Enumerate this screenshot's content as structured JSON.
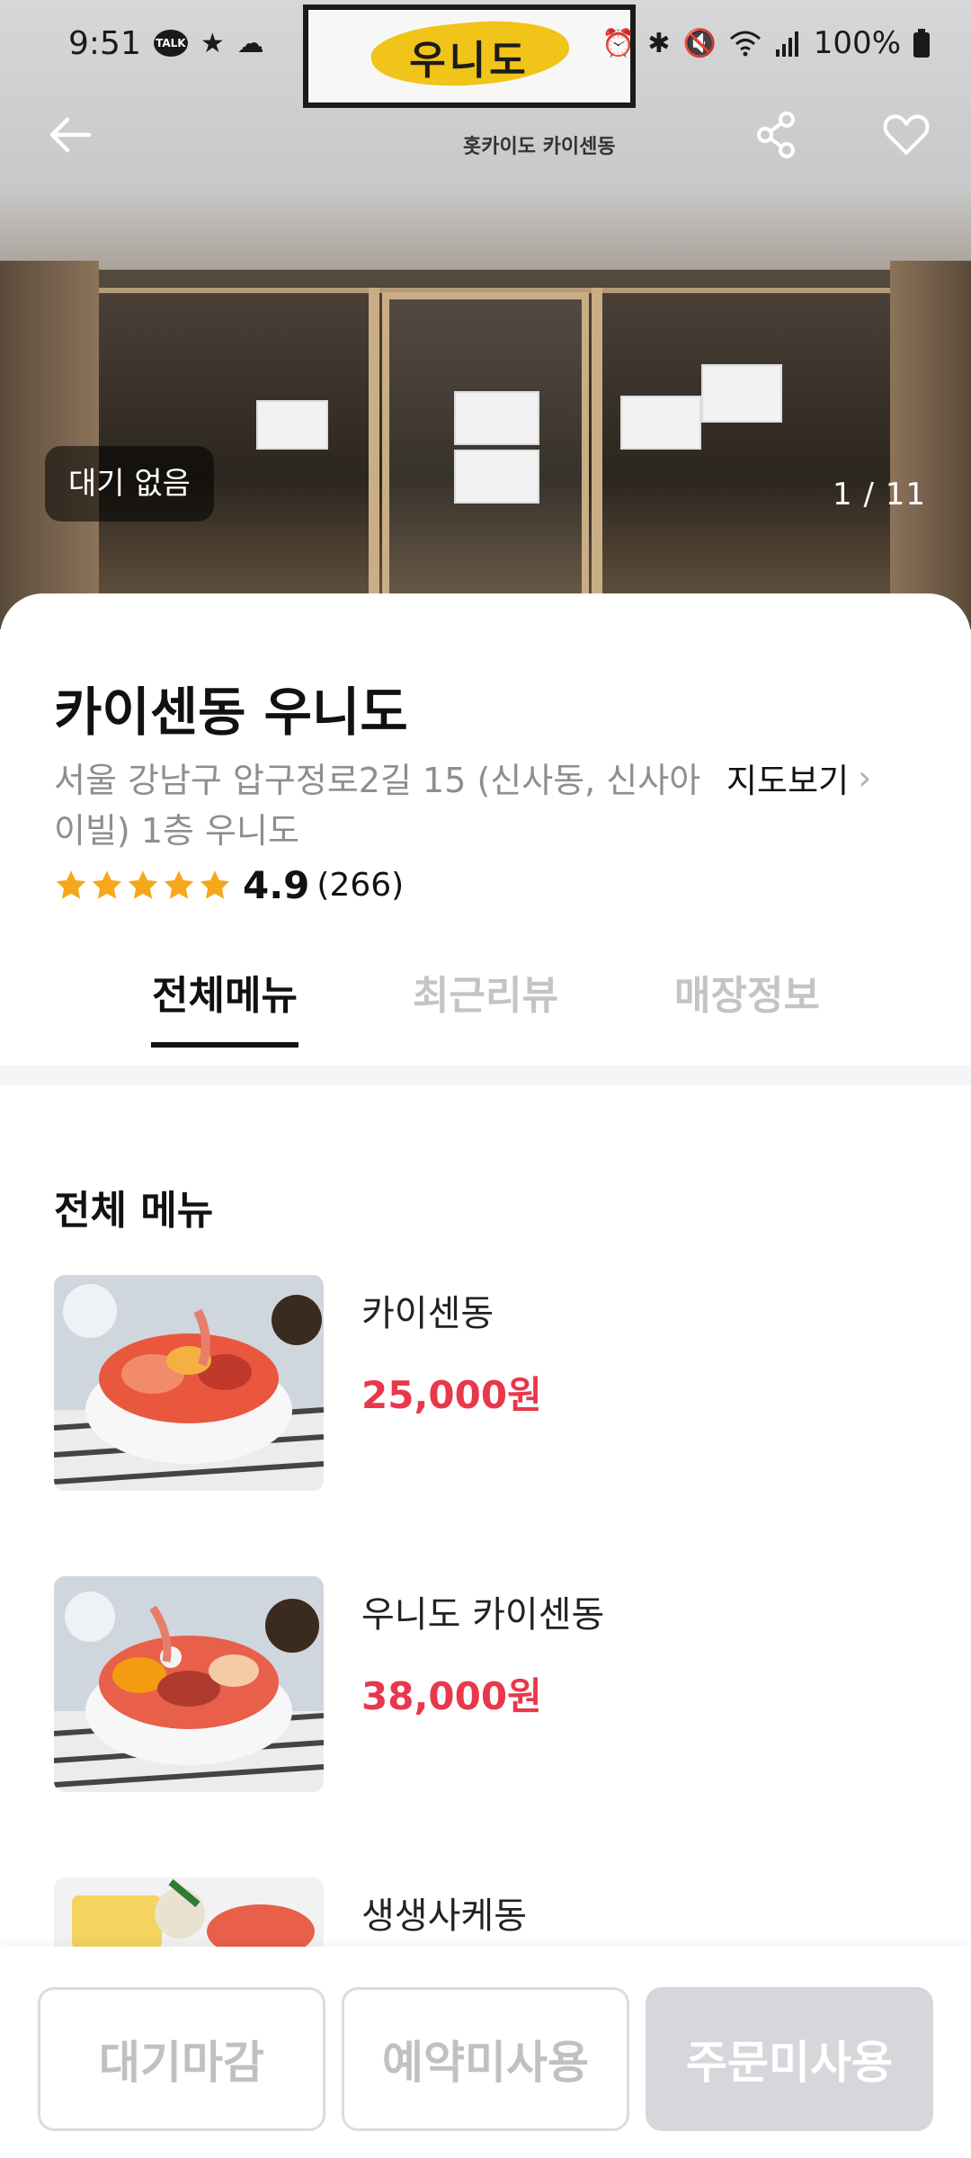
{
  "status_bar": {
    "time": "9:51",
    "talk_badge": "TALK",
    "battery": "100%",
    "icons": [
      "kakaotalk-icon",
      "star-icon",
      "cloud-icon",
      "alarm-icon",
      "bluetooth-icon",
      "mute-icon",
      "wifi-icon",
      "signal-icon",
      "battery-icon"
    ]
  },
  "hero": {
    "sign_text": "우니도",
    "sub_sign": "홋카이도 카이센동",
    "wait_status": "대기 없음",
    "photo_counter": "1 / 11"
  },
  "nav": {
    "icons": [
      "back-arrow-icon",
      "share-icon",
      "heart-icon"
    ]
  },
  "store": {
    "name": "카이센동 우니도",
    "address": "서울 강남구 압구정로2길 15 (신사동, 신사아이빌) 1층 우니도",
    "map_link": "지도보기",
    "rating": "4.9",
    "review_count": "(266)",
    "stars": 5
  },
  "tabs": [
    {
      "label": "전체메뉴",
      "active": true
    },
    {
      "label": "최근리뷰",
      "active": false
    },
    {
      "label": "매장정보",
      "active": false
    }
  ],
  "menu": {
    "section_title": "전체 메뉴",
    "items": [
      {
        "name": "카이센동",
        "price": "25,000원"
      },
      {
        "name": "우니도 카이센동",
        "price": "38,000원"
      },
      {
        "name": "생생사케동",
        "price": ""
      }
    ]
  },
  "bottom_buttons": [
    {
      "label": "대기마감"
    },
    {
      "label": "예약미사용"
    },
    {
      "label": "주문미사용"
    }
  ],
  "colors": {
    "price": "#e8384b",
    "star": "#f6a71b",
    "tab_inactive": "#c4c4c4",
    "disabled_fill": "#d5d7db"
  }
}
